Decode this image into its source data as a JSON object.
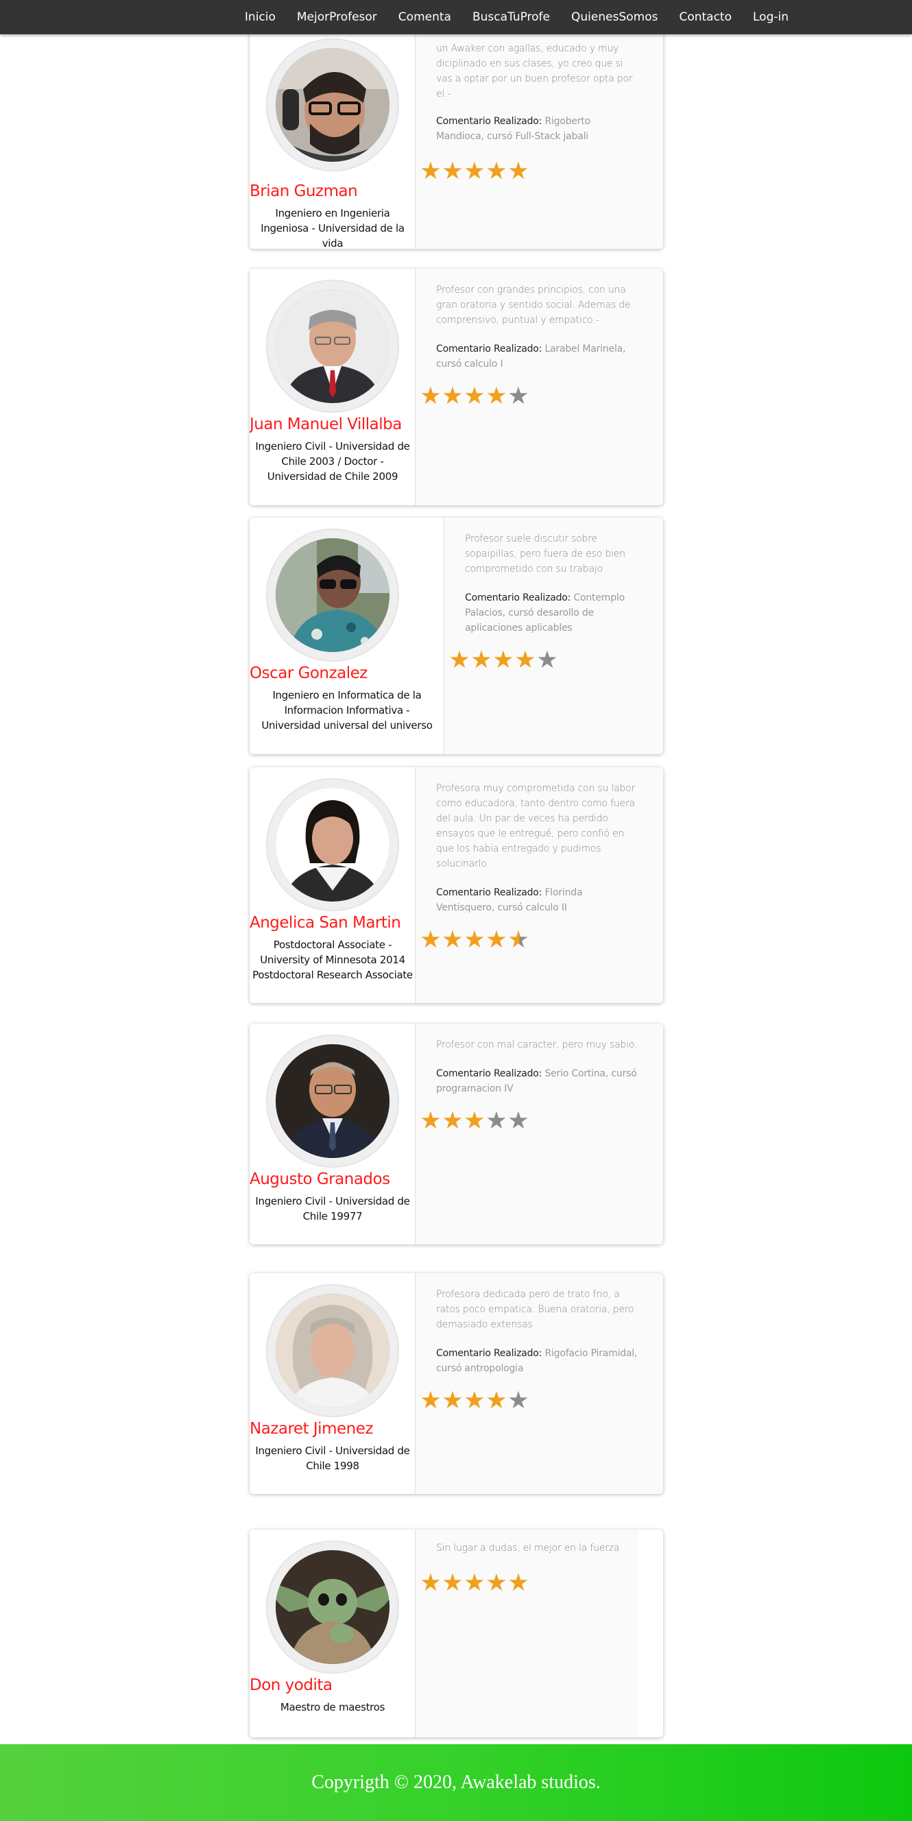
{
  "nav": {
    "items": [
      "Inicio",
      "MejorProfesor",
      "Comenta",
      "BuscaTuProfe",
      "QuienesSomos",
      "Contacto",
      "Log-in"
    ]
  },
  "comment_label": "Comentario Realizado:",
  "professors": [
    {
      "name": "Brian Guzman",
      "title": "Ingeniero en Ingenieria Ingeniosa - Universidad de la vida",
      "comment": "un Awaker con agallas, educado y muy diciplinado en sus clases, yo creo que si vas a optar por un buen profesor opta por el.-",
      "commenter": "Rigoberto Mandioca, cursó Full-Stack jabali",
      "rating": 5
    },
    {
      "name": "Juan Manuel Villalba",
      "title": "Ingeniero Civil - Universidad de Chile 2003 / Doctor - Universidad de Chile 2009",
      "comment": "Profesor con grandes principios, con una gran oratoria y sentido social. Ademas de comprensivo, puntual y empatico.-",
      "commenter": "Larabel Marinela, cursó calculo I",
      "rating": 4
    },
    {
      "name": "Oscar Gonzalez",
      "title": "Ingeniero en Informatica de la Informacion Informativa - Universidad universal del universo",
      "comment": "Profesor suele discutir sobre sopaipillas, pero fuera de eso bien comprometido con su trabajo",
      "commenter": "Contemplo Palacios, cursó desarollo de aplicaciones aplicables",
      "rating": 4
    },
    {
      "name": "Angelica San Martin",
      "title": "Postdoctoral Associate - University of Minnesota 2014 Postdoctoral Research Associate",
      "comment": "Profesora muy comprometida con su labor como educadora, tanto dentro como fuera del aula. Un par de veces ha perdido ensayos que le entregué, pero confió en que los habia entregado y pudimos solucinarlo.",
      "commenter": "Florinda Ventisquero, cursó calculo II",
      "rating": 4.5
    },
    {
      "name": "Augusto Granados",
      "title": "Ingeniero Civil - Universidad de Chile 19977",
      "comment": "Profesor con mal caracter, pero muy sabio.",
      "commenter": "Serio Cortina, cursó programacion IV",
      "rating": 3
    },
    {
      "name": "Nazaret Jimenez",
      "title": "Ingeniero Civil - Universidad de Chile 1998",
      "comment": "Profesora dedicada pero de trato frio, a ratos poco empatica. Buena oratoria, pero demasiado extensas",
      "commenter": "Rigofacio Piramidal, cursó antropologia",
      "rating": 4
    },
    {
      "name": "Don yodita",
      "title": "Maestro de maestros",
      "comment": "Sin lugar a dudas, el mejor en la fuerza",
      "commenter": "",
      "rating": 5
    }
  ],
  "footer": {
    "text": "Copyrigth © 2020, Awakelab studios."
  },
  "colors": {
    "navbar": "#343434",
    "name": "#ff1a1a",
    "star_on": "#f0a01e",
    "star_off": "#8c8c8c",
    "footer_start": "#55d13d",
    "footer_end": "#0ec80f"
  }
}
